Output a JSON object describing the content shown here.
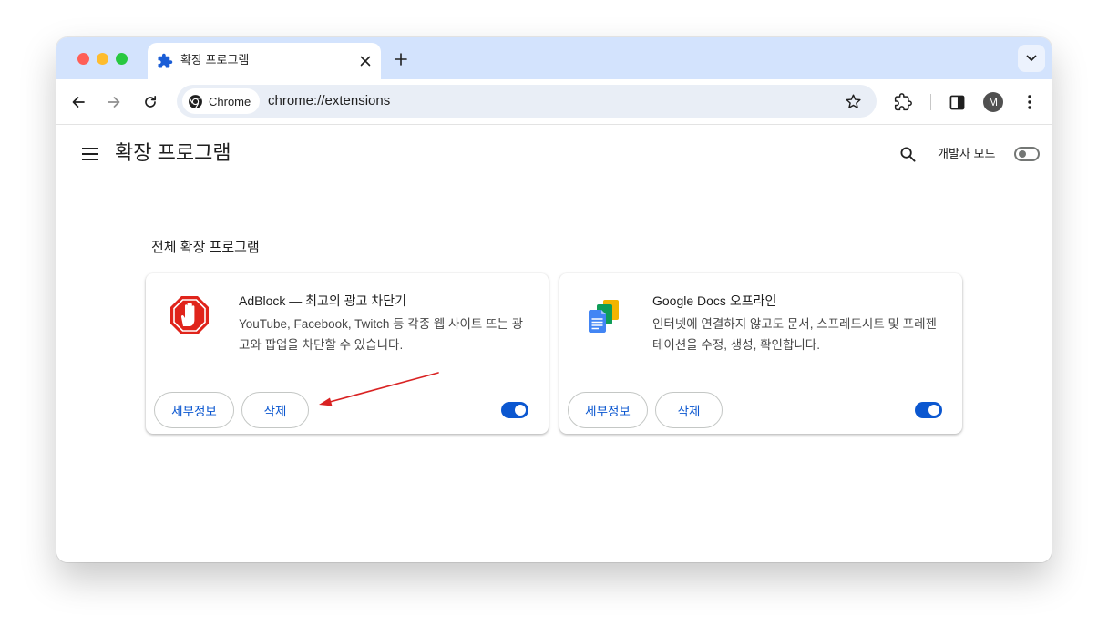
{
  "tab": {
    "title": "확장 프로그램",
    "icon": "puzzle-icon"
  },
  "omnibox": {
    "chip_label": "Chrome",
    "url": "chrome://extensions"
  },
  "avatar": {
    "initial": "M"
  },
  "page": {
    "title": "확장 프로그램",
    "developer_mode_label": "개발자 모드",
    "developer_mode_on": false,
    "section_title": "전체 확장 프로그램"
  },
  "extensions": [
    {
      "name": "AdBlock — 최고의 광고 차단기",
      "description": "YouTube, Facebook, Twitch 등 각종 웹 사이트 뜨는 광고와 팝업을 차단할 수 있습니다.",
      "details_label": "세부정보",
      "remove_label": "삭제",
      "enabled": true,
      "icon": "adblock-stop-hand-icon"
    },
    {
      "name": "Google Docs 오프라인",
      "description": "인터넷에 연결하지 않고도 문서, 스프레드시트 및 프레젠테이션을 수정, 생성, 확인합니다.",
      "details_label": "세부정보",
      "remove_label": "삭제",
      "enabled": true,
      "icon": "google-docs-icon"
    }
  ],
  "colors": {
    "tabstrip": "#d3e3fd",
    "accent": "#0b57d0",
    "adblock_red": "#e0241b",
    "annotation_arrow": "#d92222"
  }
}
